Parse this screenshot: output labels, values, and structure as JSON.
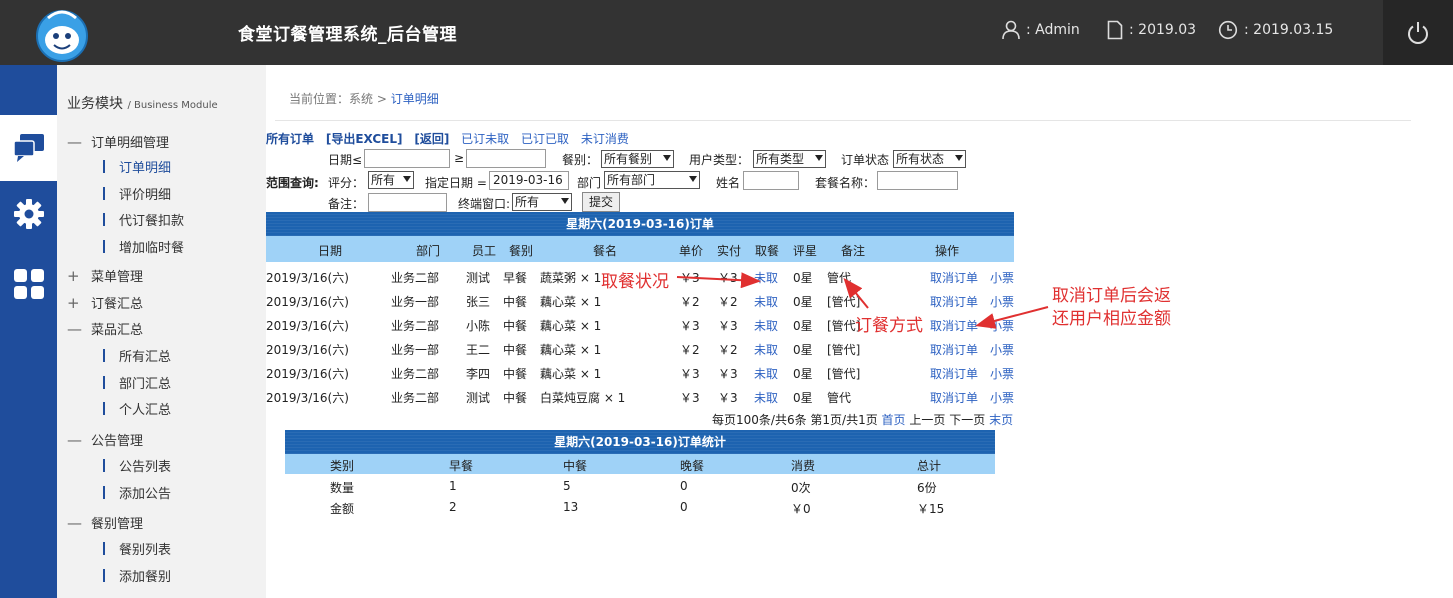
{
  "header": {
    "title": "食堂订餐管理系统_后台管理",
    "user": "Admin",
    "period": "2019.03",
    "date": "2019.03.15",
    "sep": ":"
  },
  "sidebar": {
    "module_title": "业务模块",
    "module_title_en": "/ Business Module",
    "groups": [
      {
        "mark": "—",
        "label": "订单明细管理",
        "items": [
          "订单明细",
          "评价明细",
          "代订餐扣款",
          "增加临时餐"
        ]
      },
      {
        "mark": "+",
        "label": "菜单管理",
        "items": []
      },
      {
        "mark": "+",
        "label": "订餐汇总",
        "items": []
      },
      {
        "mark": "—",
        "label": "菜品汇总",
        "items": [
          "所有汇总",
          "部门汇总",
          "个人汇总"
        ]
      },
      {
        "mark": "—",
        "label": "公告管理",
        "items": [
          "公告列表",
          "添加公告"
        ]
      },
      {
        "mark": "—",
        "label": "餐别管理",
        "items": [
          "餐别列表",
          "添加餐别"
        ]
      }
    ]
  },
  "breadcrumb": {
    "prefix": "当前位置：系统",
    "sep": ">",
    "current": "订单明细"
  },
  "toolbar": {
    "all_orders": "所有订单",
    "export": "[导出EXCEL]",
    "back": "[返回]",
    "ordered_not_taken": "已订未取",
    "ordered_taken": "已订已取",
    "not_ordered": "未订消费"
  },
  "filters": {
    "range_label": "范围查询:",
    "date_le": "日期≤",
    "date_ge": "≥",
    "meal_label": "餐别：",
    "meal_value": "所有餐别",
    "user_type_label": "用户类型：",
    "user_type_value": "所有类型",
    "status_label": "订单状态",
    "status_value": "所有状态",
    "rating_label": "评分：",
    "rating_value": "所有",
    "date_eq_label": "指定日期 =",
    "date_eq_value": "2019-03-16",
    "dept_label": "部门",
    "dept_value": "所有部门",
    "name_label": "姓名",
    "set_name_label": "套餐名称：",
    "remark_label": "备注：",
    "terminal_label": "终端窗口:",
    "terminal_value": "所有",
    "submit": "提交"
  },
  "orders": {
    "title": "星期六(2019-03-16)订单",
    "columns": [
      "日期",
      "部门",
      "员工",
      "餐别",
      "餐名",
      "单价",
      "实付",
      "取餐",
      "评星",
      "备注",
      "操作"
    ],
    "rows": [
      {
        "date": "2019/3/16(六)",
        "dept": "业务二部",
        "emp": "测试",
        "meal": "早餐",
        "dish": "蔬菜粥 × 1",
        "price": "￥3",
        "paid": "￥3",
        "take": "未取",
        "star": "0星",
        "remark": "管代",
        "cancel": "取消订单",
        "ticket": "小票"
      },
      {
        "date": "2019/3/16(六)",
        "dept": "业务一部",
        "emp": "张三",
        "meal": "中餐",
        "dish": "藕心菜 × 1",
        "price": "￥2",
        "paid": "￥2",
        "take": "未取",
        "star": "0星",
        "remark": "[管代]",
        "cancel": "取消订单",
        "ticket": "小票"
      },
      {
        "date": "2019/3/16(六)",
        "dept": "业务二部",
        "emp": "小陈",
        "meal": "中餐",
        "dish": "藕心菜 × 1",
        "price": "￥3",
        "paid": "￥3",
        "take": "未取",
        "star": "0星",
        "remark": "[管代]",
        "cancel": "取消订单",
        "ticket": "小票"
      },
      {
        "date": "2019/3/16(六)",
        "dept": "业务一部",
        "emp": "王二",
        "meal": "中餐",
        "dish": "藕心菜 × 1",
        "price": "￥2",
        "paid": "￥2",
        "take": "未取",
        "star": "0星",
        "remark": "[管代]",
        "cancel": "取消订单",
        "ticket": "小票"
      },
      {
        "date": "2019/3/16(六)",
        "dept": "业务二部",
        "emp": "李四",
        "meal": "中餐",
        "dish": "藕心菜 × 1",
        "price": "￥3",
        "paid": "￥3",
        "take": "未取",
        "star": "0星",
        "remark": "[管代]",
        "cancel": "取消订单",
        "ticket": "小票"
      },
      {
        "date": "2019/3/16(六)",
        "dept": "业务二部",
        "emp": "测试",
        "meal": "中餐",
        "dish": "白菜炖豆腐 × 1",
        "price": "￥3",
        "paid": "￥3",
        "take": "未取",
        "star": "0星",
        "remark": "管代",
        "cancel": "取消订单",
        "ticket": "小票"
      }
    ]
  },
  "pager": {
    "info": "每页100条/共6条 第1页/共1页",
    "first": "首页",
    "prev": "上一页",
    "next": "下一页",
    "last": "末页"
  },
  "stats": {
    "title": "星期六(2019-03-16)订单统计",
    "columns": [
      "类别",
      "早餐",
      "中餐",
      "晚餐",
      "消费",
      "总计"
    ],
    "rows": [
      [
        "数量",
        "1",
        "5",
        "0",
        "0次",
        "6份"
      ],
      [
        "金额",
        "2",
        "13",
        "0",
        "￥0",
        "￥15"
      ]
    ]
  },
  "annotations": {
    "take_status": "取餐状况",
    "order_method": "订餐方式",
    "cancel_note_1": "取消订单后会返",
    "cancel_note_2": "还用户相应金额",
    "color": "#e03030"
  },
  "colors": {
    "header_bg": "#333333",
    "iconbar_bg": "#1f4d9c",
    "table_title_bg": "#1d63b0",
    "table_head_bg": "#9fd2f7",
    "link": "#2e62c2"
  }
}
